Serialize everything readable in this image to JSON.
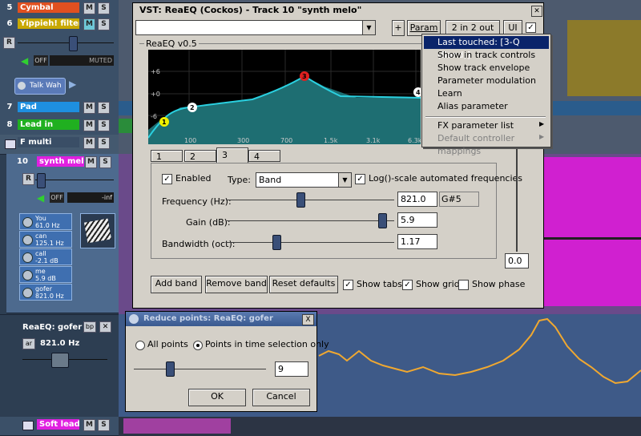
{
  "tracks": [
    {
      "num": "5",
      "name": "Cymbal",
      "color": "#e05020"
    },
    {
      "num": "6",
      "name": "Yippieh! filter i",
      "color": "#e0c000"
    },
    {
      "num": "7",
      "name": "Pad",
      "color": "#1e8fe0"
    },
    {
      "num": "8",
      "name": "Lead in",
      "color": "#20b020"
    },
    {
      "num": "",
      "name": "F multi",
      "color": "#3a4e66"
    },
    {
      "num": "10",
      "name": "synth melo",
      "color": "#e020e0"
    },
    {
      "num": "",
      "name": "Soft lead (",
      "color": "#e020e0"
    }
  ],
  "track_buttons": {
    "mute": "M",
    "solo": "S",
    "rec": "R"
  },
  "track6": {
    "muted_label": "MUTED",
    "off_label": "OFF",
    "fx_button": "Talk Wah"
  },
  "track10": {
    "off_label": "OFF",
    "meter_label": "-inf",
    "params": [
      {
        "name": "You",
        "value": "61.0 Hz"
      },
      {
        "name": "can",
        "value": "125.1 Hz"
      },
      {
        "name": "call",
        "value": "-2.1 dB"
      },
      {
        "name": "me",
        "value": "5.9 dB"
      },
      {
        "name": "gofer",
        "value": "821.0 Hz"
      }
    ]
  },
  "envelope_panel": {
    "title": "ReaEQ: gofer",
    "bp": "bp",
    "value": "821.0 Hz",
    "mode": "ar"
  },
  "vst": {
    "title": "VST: ReaEQ (Cockos) - Track 10 \"synth melo\"",
    "plus": "+",
    "param": "Param",
    "io": "2 in 2 out",
    "ui": "UI",
    "version": "ReaEQ v0.5",
    "db_labels": [
      "+6",
      "+0",
      "-6"
    ],
    "freq_labels": [
      "100",
      "300",
      "700",
      "1.5k",
      "3.1k",
      "6.3k"
    ],
    "band_points": [
      "1",
      "2",
      "3",
      "4"
    ],
    "tabs": [
      "1",
      "2",
      "3",
      "4"
    ],
    "enabled_label": "Enabled",
    "type_label": "Type:",
    "type_value": "Band",
    "log_label": "Log()-scale automated frequencies",
    "freq_label": "Frequency (Hz):",
    "freq_value": "821.0",
    "note": "G#5",
    "gain_label": "Gain (dB):",
    "gain_value": "5.9",
    "bw_label": "Bandwidth (oct):",
    "bw_value": "1.17",
    "side_value": "0.0",
    "add_band": "Add band",
    "remove_band": "Remove band",
    "reset": "Reset defaults",
    "show_tabs": "Show tabs",
    "show_grid": "Show grid",
    "show_phase": "Show phase"
  },
  "menu": {
    "items": [
      {
        "label": "Last touched: [3-Q (Band)]",
        "state": "highlighted"
      },
      {
        "label": "Show in track controls",
        "state": "normal"
      },
      {
        "label": "Show track envelope",
        "state": "normal"
      },
      {
        "label": "Parameter modulation",
        "state": "normal"
      },
      {
        "label": "Learn",
        "state": "normal"
      },
      {
        "label": "Alias parameter",
        "state": "normal"
      },
      {
        "label": "FX parameter list",
        "state": "submenu"
      },
      {
        "label": "Default controller mappings",
        "state": "disabled-submenu"
      }
    ]
  },
  "dialog": {
    "title": "Reduce points: ReaEQ: gofer",
    "close": "X",
    "all_points": "All points",
    "time_sel": "Points in time selection only",
    "value": "9",
    "ok": "OK",
    "cancel": "Cancel"
  },
  "colors": {
    "eq_bg": "#000000",
    "eq_fill": "#1e6e72",
    "eq_curve": "#2ad0e0",
    "envelope": "#f0a830",
    "magenta_item": "#d020d0",
    "highlight": "#0a246a"
  }
}
